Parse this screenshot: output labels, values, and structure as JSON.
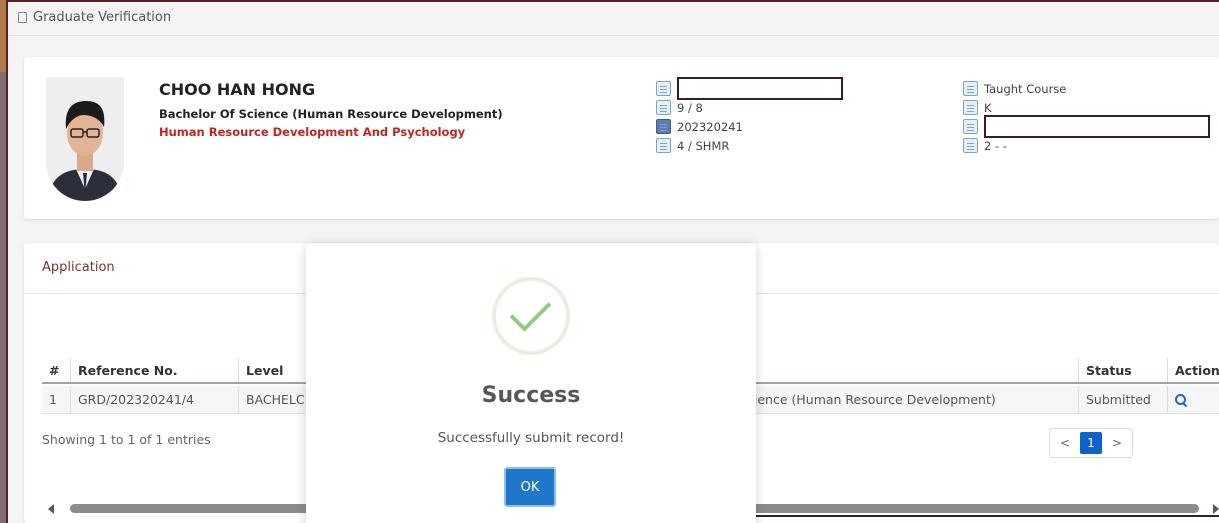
{
  "breadcrumb": {
    "label": "Graduate Verification"
  },
  "profile": {
    "name": "CHOO HAN HONG",
    "degree": "Bachelor Of Science (Human Resource Development)",
    "program": "Human Resource Development And Psychology",
    "info_left": [
      "9 / 8",
      "202320241",
      "4 / SHMR"
    ],
    "info_right": [
      "Taught Course",
      "K",
      "2 - -"
    ]
  },
  "application": {
    "title": "Application",
    "columns": [
      "#",
      "Reference No.",
      "Level",
      "Status",
      "Action"
    ],
    "rows": [
      {
        "num": "1",
        "ref": "GRD/202320241/4",
        "level": "BACHELC",
        "program": "cience (Human Resource Development)",
        "status": "Submitted"
      }
    ],
    "entries_text": "Showing 1 to 1 of 1 entries",
    "pager": {
      "prev": "<",
      "current": "1",
      "next": ">"
    }
  },
  "modal": {
    "title": "Success",
    "message": "Successfully submit record!",
    "ok_label": "OK"
  },
  "colors": {
    "accent": "#1f77c9",
    "status_red": "#c0261f",
    "success_green": "#93c97a",
    "frame": "#5a1f24"
  }
}
